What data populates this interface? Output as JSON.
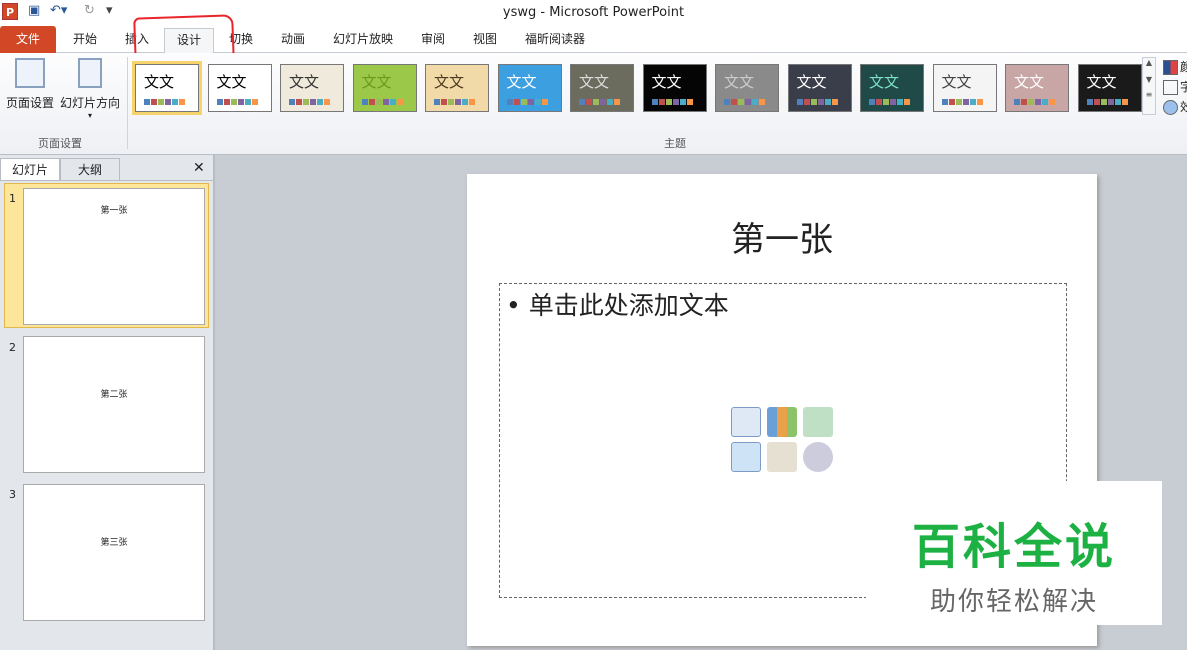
{
  "titlebar": {
    "title": "yswg  -  Microsoft PowerPoint",
    "logo": "P",
    "save_icon": "save-icon",
    "undo_icon": "undo-icon",
    "redo_icon": "redo-icon"
  },
  "tabs": [
    "文件",
    "开始",
    "插入",
    "设计",
    "切换",
    "动画",
    "幻灯片放映",
    "审阅",
    "视图",
    "福昕阅读器"
  ],
  "active_tab": "设计",
  "ribbon": {
    "page_setup": {
      "btn1": "页面设置",
      "btn2": "幻灯片方向",
      "group": "页面设置"
    },
    "themes_group": "主题",
    "themes": [
      {
        "label": "文文",
        "bg": "#ffffff",
        "fg": "#000"
      },
      {
        "label": "文文",
        "bg": "#ffffff",
        "fg": "#000"
      },
      {
        "label": "文文",
        "bg": "#efeadb",
        "fg": "#333"
      },
      {
        "label": "文文",
        "bg": "#9cc84a",
        "fg": "#6a9a1a"
      },
      {
        "label": "文文",
        "bg": "#f1d9a8",
        "fg": "#4a3a20"
      },
      {
        "label": "文文",
        "bg": "#3c9fe0",
        "fg": "#fff"
      },
      {
        "label": "文文",
        "bg": "#6b6c5e",
        "fg": "#ddd"
      },
      {
        "label": "文文",
        "bg": "#050505",
        "fg": "#fff"
      },
      {
        "label": "文文",
        "bg": "#8a8a8a",
        "fg": "#ccc"
      },
      {
        "label": "文文",
        "bg": "#3a3d4a",
        "fg": "#fff"
      },
      {
        "label": "文文",
        "bg": "#1f4a48",
        "fg": "#7fe0c8"
      },
      {
        "label": "文文",
        "bg": "#f4f4f4",
        "fg": "#444"
      },
      {
        "label": "文文",
        "bg": "#c9a6a6",
        "fg": "#fff"
      },
      {
        "label": "文文",
        "bg": "#1a1a1a",
        "fg": "#fff"
      }
    ],
    "right": [
      "颜色",
      "字体",
      "效果"
    ]
  },
  "panel": {
    "tab1": "幻灯片",
    "tab2": "大纲",
    "close": "✕",
    "slides": [
      {
        "num": "1",
        "title": "第一张"
      },
      {
        "num": "2",
        "title": "第二张"
      },
      {
        "num": "3",
        "title": "第三张"
      }
    ]
  },
  "slide": {
    "title": "第一张",
    "bullet": "•",
    "placeholder": "单击此处添加文本"
  },
  "watermark": {
    "line1": "百科全说",
    "line2": "助你轻松解决"
  }
}
